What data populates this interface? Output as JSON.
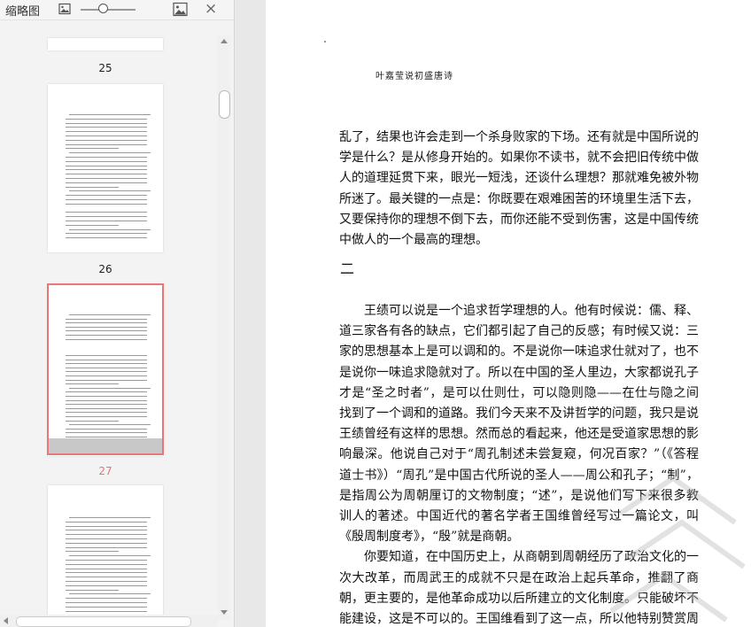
{
  "thumbnail_pane": {
    "title": "缩略图",
    "icons": [
      "image-small-icon",
      "image-large-icon",
      "close-icon"
    ],
    "close_glyph": "×",
    "pages": [
      {
        "number": "25",
        "state": "normal"
      },
      {
        "number": "26",
        "state": "normal"
      },
      {
        "number": "27",
        "state": "selected"
      }
    ],
    "selected_color": "#e87777"
  },
  "document": {
    "running_head": "叶嘉莹说初盛唐诗",
    "paragraph_1": "乱了，结果也许会走到一个杀身败家的下场。还有就是中国所说的学是什么？是从修身开始的。如果你不读书，就不会把旧传统中做人的道理延贯下来，眼光一短浅，还谈什么理想？那就难免被外物所迷了。最关键的一点是：你既要在艰难困苦的环境里生活下去，又要保持你的理想不倒下去，而你还能不受到伤害，这是中国传统中做人的一个最高的理想。",
    "section_number": "二",
    "paragraph_2": "王绩可以说是一个追求哲学理想的人。他有时候说：儒、释、道三家各有各的缺点，它们都引起了自己的反感；有时候又说：三家的思想基本上是可以调和的。不是说你一味追求仕就对了，也不是说你一味追求隐就对了。所以在中国的圣人里边，大家都说孔子才是“圣之时者”，是可以仕则仕，可以隐则隐——在仕与隐之间找到了一个调和的道路。我们今天来不及讲哲学的问题，我只是说王绩曾经有这样的思想。然而总的看起来，他还是受道家思想的影响最深。他说自己对于“周孔制述未尝复窥，何况百家？”（《答程道士书》）“周孔”是中国古代所说的圣人——周公和孔子；“制”，是指周公为周朝厘订的文物制度；“述”，是说他们写下来很多教训人的著述。中国近代的著名学者王国维曾经写过一篇论文，叫《殷周制度考》，“殷”就是商朝。",
    "paragraph_3": "你要知道，在中国历史上，从商朝到周朝经历了政治文化的一次大改革，而周武王的成就不只是在政治上起兵革命，推翻了商朝，更主要的，是他革命成功以后所建立的文化制度。只能破坏不能建设，这是不可以的。王国维看到了这一点，所以他特别赞赏周朝。他说，周朝之所以了不起，"
  }
}
